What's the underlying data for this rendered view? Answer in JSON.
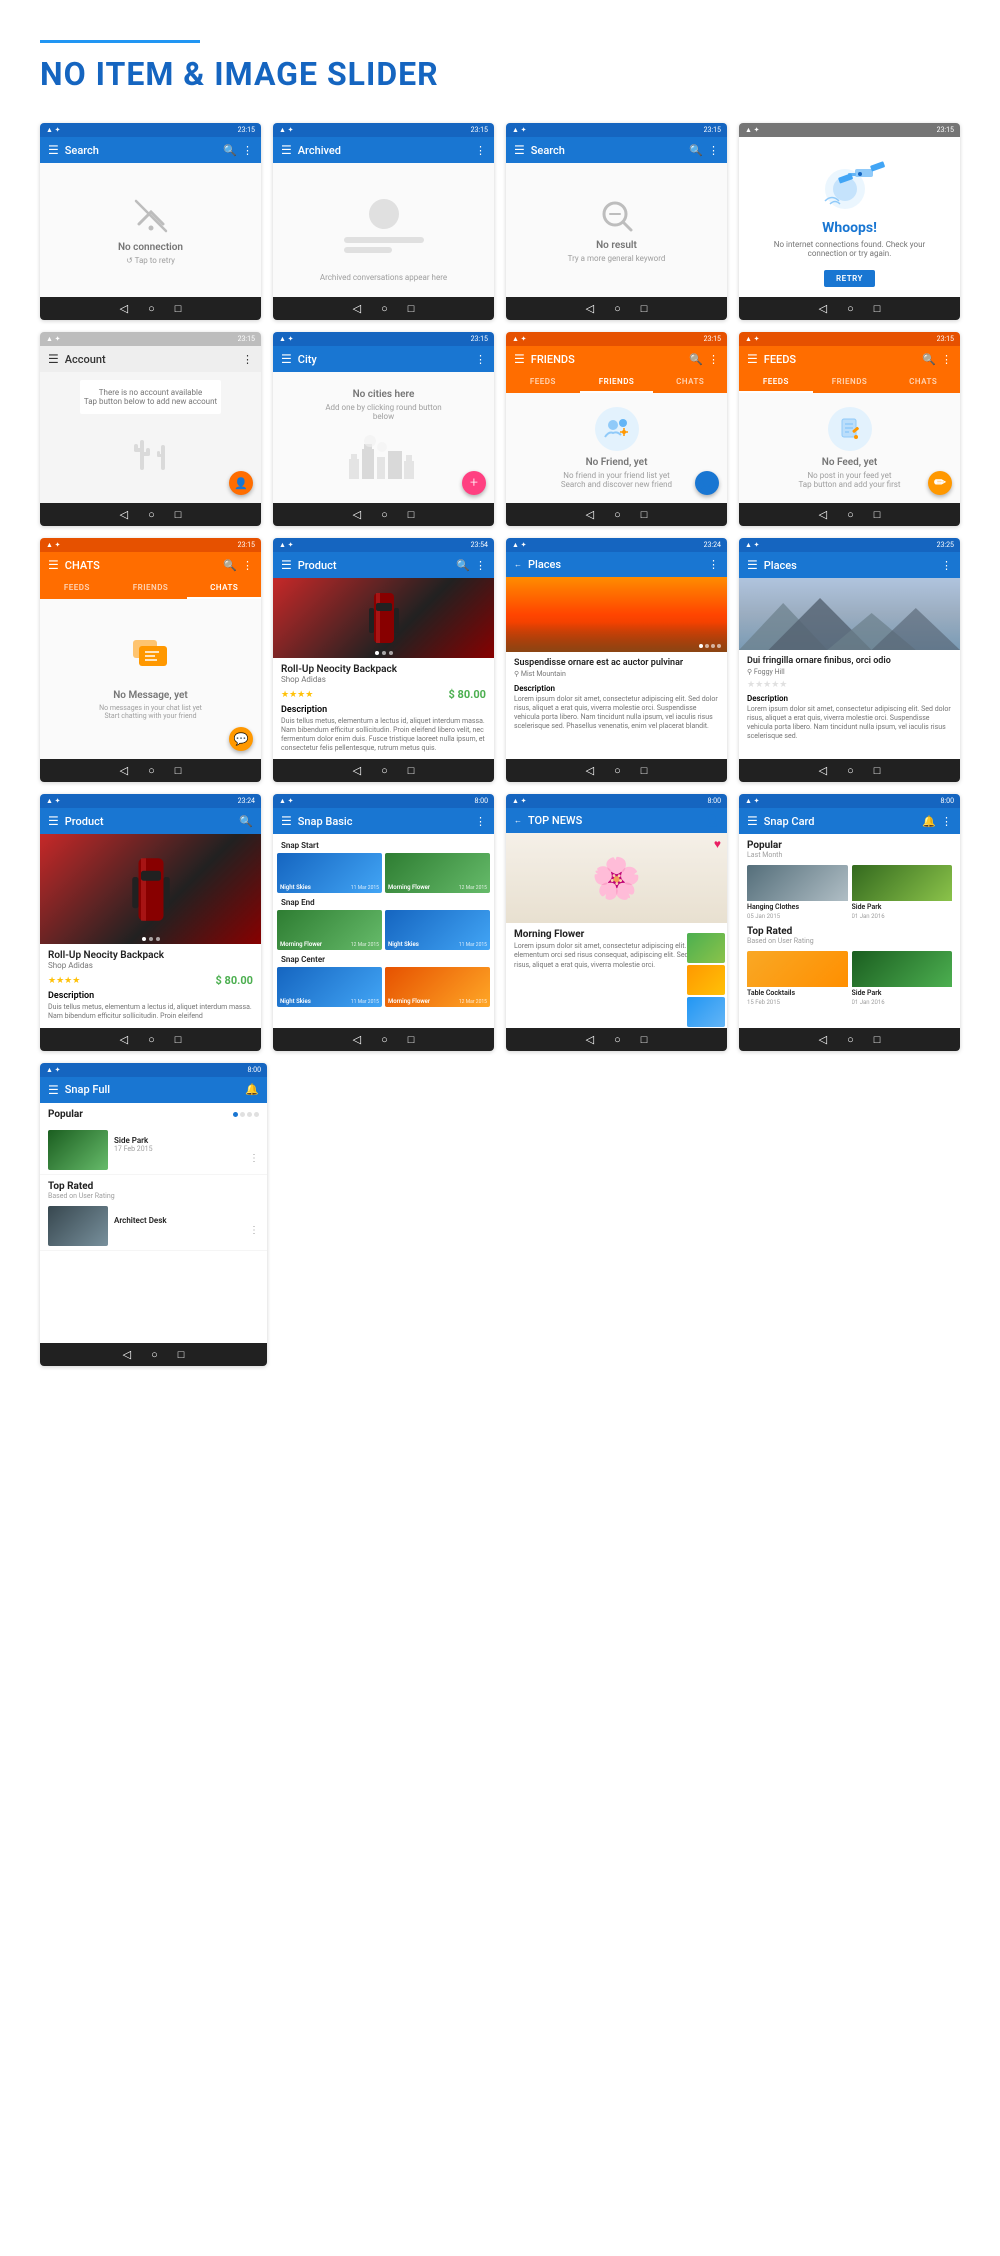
{
  "page": {
    "title": "NO ITEM & IMAGE SLIDER",
    "header_line_color": "#2196F3",
    "title_color": "#1565C0"
  },
  "rows": [
    {
      "id": "row1",
      "screens": [
        {
          "id": "search-no-conn",
          "toolbar_bg": "blue",
          "toolbar_title": "Search",
          "toolbar_icons": [
            "search",
            "more"
          ],
          "status": "23:15",
          "body_type": "no-connection",
          "empty_title": "No connection",
          "empty_subtitle": "↺ Tap to retry"
        },
        {
          "id": "archived",
          "toolbar_bg": "blue",
          "toolbar_title": "Archived",
          "toolbar_icons": [
            "more"
          ],
          "status": "23:15",
          "body_type": "archived",
          "empty_subtitle": "Archived conversations appear here"
        },
        {
          "id": "search-no-result",
          "toolbar_bg": "blue",
          "toolbar_title": "Search",
          "toolbar_icons": [
            "search",
            "more"
          ],
          "status": "23:15",
          "body_type": "no-result",
          "empty_title": "No result",
          "empty_subtitle": "Try a more general keyword"
        },
        {
          "id": "whoops",
          "toolbar_bg": "gray",
          "status": "23:15",
          "body_type": "whoops",
          "whoops_title": "Whoops!",
          "whoops_text": "No internet connections found. Check your connection or try again.",
          "retry_label": "RETRY"
        }
      ]
    },
    {
      "id": "row2",
      "screens": [
        {
          "id": "account",
          "toolbar_bg": "light-gray",
          "toolbar_title": "Account",
          "toolbar_icons": [
            "more"
          ],
          "status": "23:15",
          "body_type": "account",
          "account_msg": "There is no account available\nTap button below to add new account"
        },
        {
          "id": "city",
          "toolbar_bg": "blue",
          "toolbar_title": "City",
          "toolbar_icons": [
            "more"
          ],
          "status": "23:15",
          "body_type": "city",
          "empty_title": "No cities here",
          "empty_subtitle": "Add one by clicking round button below"
        },
        {
          "id": "friends",
          "toolbar_bg": "orange",
          "toolbar_title": "FRIENDS",
          "toolbar_icons": [
            "search",
            "more"
          ],
          "status": "23:15",
          "body_type": "friends",
          "tabs": [
            "FEEDS",
            "FRIENDS",
            "CHATS"
          ],
          "active_tab": 1,
          "empty_title": "No Friend, yet",
          "empty_subtitle": "No friend in your friend list yet\nSearch and discover new friend"
        },
        {
          "id": "feeds",
          "toolbar_bg": "orange",
          "toolbar_title": "FEEDS",
          "toolbar_icons": [
            "search",
            "more"
          ],
          "status": "23:15",
          "body_type": "feeds",
          "tabs": [
            "FEEDS",
            "FRIENDS",
            "CHATS"
          ],
          "active_tab": 0,
          "empty_title": "No Feed, yet",
          "empty_subtitle": "No post in your feed yet\nTap button and add your first"
        }
      ]
    },
    {
      "id": "row3",
      "screens": [
        {
          "id": "chats",
          "toolbar_bg": "orange",
          "toolbar_title": "CHATS",
          "toolbar_icons": [
            "search",
            "more"
          ],
          "status": "23:15",
          "body_type": "chats",
          "tabs": [
            "FEEDS",
            "FRIENDS",
            "CHATS"
          ],
          "active_tab": 2,
          "empty_title": "No Message, yet",
          "empty_subtitle": "No messages in your chat list yet\nStart chatting with your friend"
        },
        {
          "id": "product1",
          "toolbar_bg": "blue",
          "toolbar_title": "Product",
          "toolbar_icons": [
            "search",
            "more"
          ],
          "status": "23:54",
          "body_type": "product",
          "product_name": "Roll-Up Neocity Backpack",
          "product_shop": "Shop Adidas",
          "product_price": "$80.00",
          "product_desc_title": "Description",
          "product_desc": "Duis tellus metus, elementum a lectus id, aliquet interdum massa. Nam bibendum efficitur sollicitudin. Proin eleifend libero velit, nec fermentum dolo enim duis. Fusce tristique laoreet nulla ipsum, et consectetur felis pellentesque, rutrum metus quis. Dignissim erat, at auctor massa dolor elementum."
        },
        {
          "id": "places1",
          "toolbar_bg": "blue",
          "toolbar_title": "Places",
          "toolbar_icons": [
            "more"
          ],
          "status": "23:24",
          "body_type": "places-sunset",
          "places_desc": "Suspendisse ornare est ac auctor pulvinar",
          "places_loc": "⚲ Mist Mountain",
          "desc_title": "Description",
          "desc_text": "Lorem ipsum dolor sit amet, consectetur adipiscing elit. Sed dolor risus, aliquet a erat quis, viverra molestie orci. Suspendisse vehicula porta libero. Nam tincidunt nulla ipsum, vel iaculis risus scelerisque sed. Phasellus venenatis, enim vel placerat blandit, leo eros bibendum erat, at auctor massa diam arcu metus. Aenean sit amet congue risque, sit amet condimentum elit. Fusce lacinia massa vel risus scelerisque, in scelerisque dolor elementum. Vivamus leo enim, congue dictum congue vitae, porttitor id"
        },
        {
          "id": "places2",
          "toolbar_bg": "blue",
          "toolbar_title": "Places",
          "toolbar_icons": [
            "more"
          ],
          "status": "23:25",
          "body_type": "places-mountains",
          "places_desc": "Dui fringilla ornare finibus, orci odio",
          "places_loc": "⚲ Foggy Hill",
          "desc_title": "Description",
          "desc_text": "Lorem ipsum dolor sit amet, consectetur adipiscing elit. Sed dolor risus, aliquet a erat quis, viverra molestie orci. Suspendisse vehicula porta libero. Nam tincidunt nulla ipsum, vel iaculis risus scelerisque sed. Phasellus venenatis, enim vel placerat blandit, leo eros bibendum erat, at auctor massa diam arcu metus."
        }
      ]
    },
    {
      "id": "row4",
      "screens": [
        {
          "id": "product2",
          "toolbar_bg": "blue",
          "toolbar_title": "Product",
          "toolbar_icons": [
            "search"
          ],
          "status": "23:24",
          "body_type": "product-large",
          "product_name": "Roll-Up Neocity Backpack",
          "product_shop": "Shop Adidas",
          "product_price": "$80.00",
          "product_desc_title": "Description",
          "product_desc": "Duis tellus metus, elementum a lectus id, aliquet interdum massa. Nam bibendum efficitur sollicitudin. Proin eleifend"
        },
        {
          "id": "snap-basic",
          "toolbar_bg": "blue",
          "toolbar_title": "Snap Basic",
          "toolbar_icons": [
            "more"
          ],
          "status": "8:00",
          "body_type": "snap-basic",
          "snap_start": "Snap Start",
          "snap_end": "Snap End",
          "snap_center": "Snap Center",
          "cells": [
            {
              "label": "Night Skies",
              "date": "11 Mar 2015",
              "color": "blue"
            },
            {
              "label": "Morning Flower",
              "date": "12 Mar 2015",
              "color": "green"
            },
            {
              "label": "Morning Flower",
              "date": "12 Mar 2015",
              "color": "green"
            },
            {
              "label": "Night Skies",
              "date": "11 Mar 2015",
              "color": "blue"
            },
            {
              "label": "Night Skies",
              "date": "11 Mar 2015",
              "color": "blue"
            },
            {
              "label": "Morning Flower",
              "date": "12 Mar 2015",
              "color": "orange"
            }
          ]
        },
        {
          "id": "top-news",
          "toolbar_bg": "blue",
          "toolbar_title": "TOP NEWS",
          "toolbar_icons": [
            "person"
          ],
          "status": "8:00",
          "body_type": "top-news",
          "news_title": "Morning Flower",
          "news_text": "Lorem ipsum dolor sit amet, consectetur adipiscing elit. Nam elementum orci sed risus consequat, adipiscing elit. Sed dolor risus, aliquet a erat quis, viverra molestie orci. Suspendisse vehicula porta libero. Nam tincidunt nulla ipsum, vel iaculis risus scelerisque sed."
        },
        {
          "id": "snap-card",
          "toolbar_bg": "blue",
          "toolbar_title": "Snap Card",
          "toolbar_icons": [
            "bell",
            "more"
          ],
          "status": "8:00",
          "body_type": "snap-card",
          "popular_label": "Popular",
          "popular_sub": "Last Month",
          "top_rated_label": "Top Rated",
          "top_rated_sub": "Based on User Rating",
          "items": [
            {
              "name": "Hanging Clothes",
              "date": "05 Jan 2015",
              "img": "clothes"
            },
            {
              "name": "Side Park",
              "date": "01 Jan 2016",
              "img": "park"
            },
            {
              "name": "Table Cocktails",
              "date": "15 Feb 2015",
              "img": "cocktail"
            },
            {
              "name": "Side Park",
              "date": "01 Jan 2016",
              "img": "park2"
            }
          ]
        }
      ]
    },
    {
      "id": "row5",
      "screens": [
        {
          "id": "snap-full",
          "toolbar_bg": "blue",
          "toolbar_title": "Snap Full",
          "toolbar_icons": [
            "bell"
          ],
          "status": "8:00",
          "body_type": "snap-full",
          "popular_label": "Popular",
          "popular_dots": true,
          "items": [
            {
              "name": "Side Park",
              "date": "17 Feb 2015",
              "img": "park"
            },
            {
              "name": "Architect Desk",
              "date": "",
              "img": "desk"
            }
          ],
          "top_rated_label": "Top Rated",
          "top_rated_sub": "Based on User Rating"
        }
      ]
    }
  ]
}
